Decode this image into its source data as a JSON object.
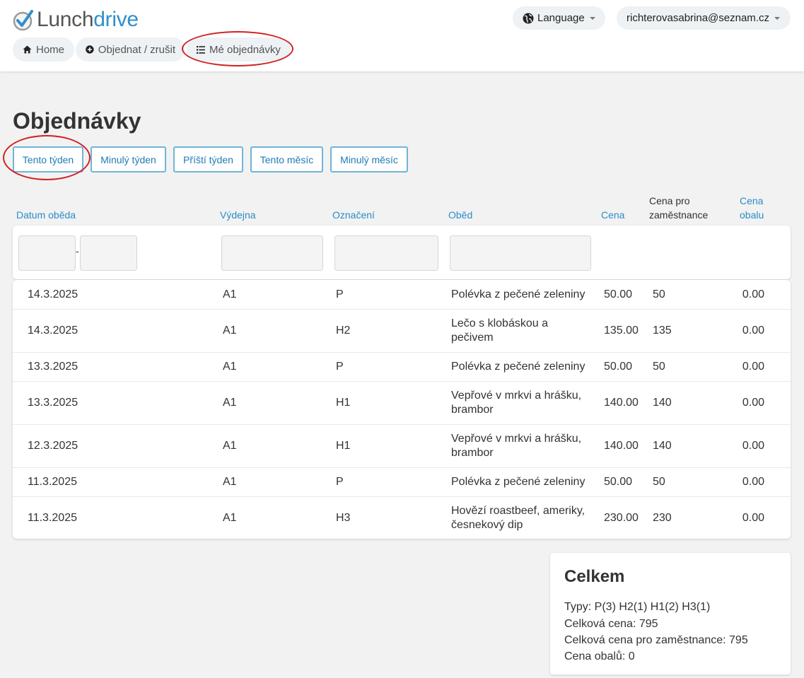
{
  "logo": {
    "part1": "Lunch",
    "part2": "drive"
  },
  "header": {
    "language_label": "Language",
    "user_email": "richterovasabrina@seznam.cz"
  },
  "nav": {
    "home": "Home",
    "order": "Objednat / zrušit",
    "my_orders": "Mé objednávky"
  },
  "page_title": "Objednávky",
  "filters": {
    "this_week": "Tento týden",
    "last_week": "Minulý týden",
    "next_week": "Příští týden",
    "this_month": "Tento měsíc",
    "last_month": "Minulý měsíc"
  },
  "table": {
    "columns": {
      "date": "Datum oběda",
      "canteen": "Výdejna",
      "code": "Označení",
      "meal": "Oběd",
      "price": "Cena",
      "employee_price_l1": "Cena pro",
      "employee_price_l2": "zaměstnance",
      "packaging_l1": "Cena",
      "packaging_l2": "obalu"
    },
    "date_range_separator": "-",
    "rows": [
      {
        "date": "14.3.2025",
        "canteen": "A1",
        "code": "P",
        "meal": "Polévka z pečené zeleniny",
        "price": "50.00",
        "employee_price": "50",
        "packaging": "0.00"
      },
      {
        "date": "14.3.2025",
        "canteen": "A1",
        "code": "H2",
        "meal": "Lečo s klobáskou a pečivem",
        "price": "135.00",
        "employee_price": "135",
        "packaging": "0.00"
      },
      {
        "date": "13.3.2025",
        "canteen": "A1",
        "code": "P",
        "meal": "Polévka z pečené zeleniny",
        "price": "50.00",
        "employee_price": "50",
        "packaging": "0.00"
      },
      {
        "date": "13.3.2025",
        "canteen": "A1",
        "code": "H1",
        "meal": "Vepřové v mrkvi a hrášku, brambor",
        "price": "140.00",
        "employee_price": "140",
        "packaging": "0.00"
      },
      {
        "date": "12.3.2025",
        "canteen": "A1",
        "code": "H1",
        "meal": "Vepřové v mrkvi a hrášku, brambor",
        "price": "140.00",
        "employee_price": "140",
        "packaging": "0.00"
      },
      {
        "date": "11.3.2025",
        "canteen": "A1",
        "code": "P",
        "meal": "Polévka z pečené zeleniny",
        "price": "50.00",
        "employee_price": "50",
        "packaging": "0.00"
      },
      {
        "date": "11.3.2025",
        "canteen": "A1",
        "code": "H3",
        "meal": "Hovězí roastbeef, ameriky, česnekový dip",
        "price": "230.00",
        "employee_price": "230",
        "packaging": "0.00"
      }
    ]
  },
  "summary": {
    "title": "Celkem",
    "types": "Typy: P(3) H2(1) H1(2) H3(1)",
    "total_price": "Celková cena: 795",
    "total_employee_price": "Celková cena pro zaměstnance: 795",
    "packaging_price": "Cena obalů: 0"
  },
  "colors": {
    "accent": "#2a8cc8",
    "logo_blue": "#2e8fca",
    "highlight_ellipse": "#d32020"
  }
}
